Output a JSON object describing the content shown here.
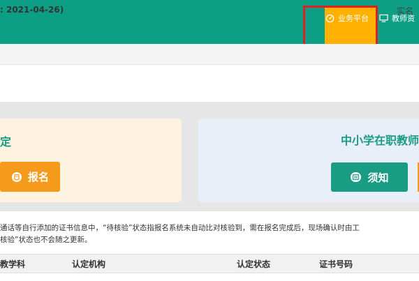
{
  "nav": {
    "tabs": [
      {
        "label": "业务平台",
        "icon": "dashboard-icon",
        "active": true
      },
      {
        "label": "教师资",
        "icon": "monitor-icon",
        "active": false
      }
    ]
  },
  "info_bar": {
    "date_text": ": 2021-04-26)",
    "realname_text": "实名"
  },
  "cards": {
    "left": {
      "title": "定",
      "button_label": "报名",
      "button_icon": "signup-icon"
    },
    "right": {
      "title": "中小学在职教师",
      "button_label": "须知",
      "button_icon": "notice-icon"
    }
  },
  "notice": {
    "line1": "通话等自行添加的证书信息中，“待核验”状态指报名系统未自动比对核验到，需在报名完成后，现场确认时由工",
    "line2": "核验”状态也不会随之更新。"
  },
  "table": {
    "headers": [
      "教学科",
      "认定机构",
      "认定状态",
      "证书号码"
    ]
  },
  "colors": {
    "nav_bg": "#0d9f86",
    "active_tab": "#ffb000",
    "highlight_border": "#e02020",
    "accent_orange": "#f59a1b",
    "accent_green": "#1a9b84"
  }
}
